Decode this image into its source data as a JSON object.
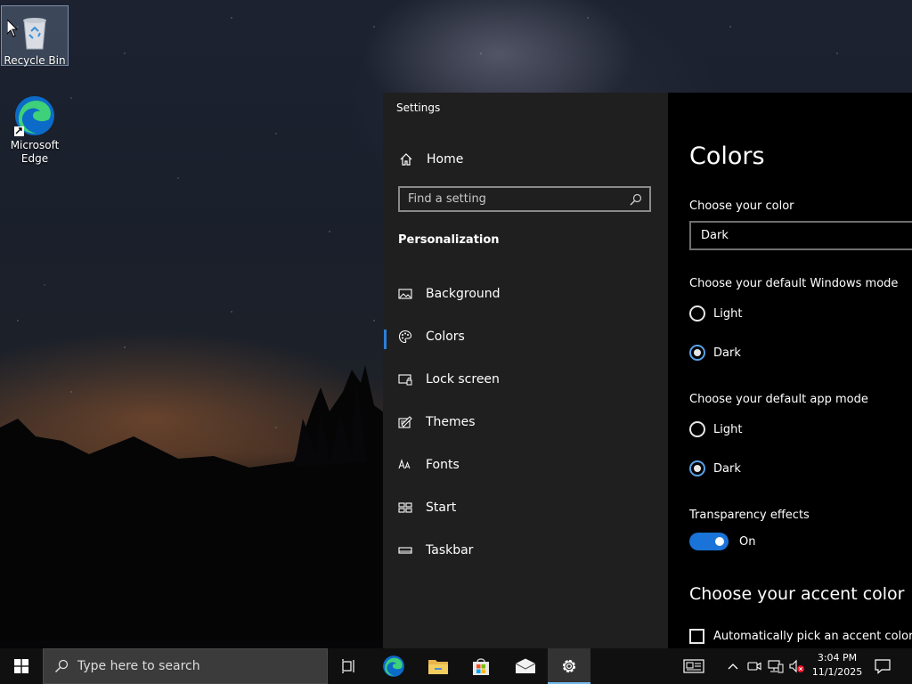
{
  "desktop": {
    "icons": [
      {
        "label": "Recycle Bin",
        "icon": "recycle-bin-icon",
        "selected": true
      },
      {
        "label": "Microsoft Edge",
        "icon": "edge-icon",
        "selected": false
      }
    ]
  },
  "settings": {
    "window_title": "Settings",
    "home_label": "Home",
    "search_placeholder": "Find a setting",
    "section_heading": "Personalization",
    "nav_items": [
      {
        "label": "Background",
        "icon": "picture-icon"
      },
      {
        "label": "Colors",
        "icon": "palette-icon",
        "active": true
      },
      {
        "label": "Lock screen",
        "icon": "lock-screen-icon"
      },
      {
        "label": "Themes",
        "icon": "themes-icon"
      },
      {
        "label": "Fonts",
        "icon": "fonts-icon"
      },
      {
        "label": "Start",
        "icon": "start-icon"
      },
      {
        "label": "Taskbar",
        "icon": "taskbar-icon"
      }
    ],
    "colors": {
      "title": "Colors",
      "choose_color_label": "Choose your color",
      "choose_color_value": "Dark",
      "windows_mode_label": "Choose your default Windows mode",
      "windows_mode_options": [
        "Light",
        "Dark"
      ],
      "windows_mode_selected": "Dark",
      "app_mode_label": "Choose your default app mode",
      "app_mode_options": [
        "Light",
        "Dark"
      ],
      "app_mode_selected": "Dark",
      "transparency_label": "Transparency effects",
      "transparency_state": "On",
      "accent_heading": "Choose your accent color",
      "auto_accent_label": "Automatically pick an accent color f",
      "auto_accent_checked": false
    },
    "accent_color": "#1a73d8"
  },
  "taskbar": {
    "search_placeholder": "Type here to search",
    "time": "3:04 PM",
    "date": "11/1/2025",
    "pinned": [
      "task-view-icon",
      "edge-icon",
      "file-explorer-icon",
      "store-icon",
      "mail-icon",
      "settings-icon"
    ],
    "tray": [
      "news-icon",
      "chevron-up-icon",
      "meet-now-icon",
      "network-icon",
      "volume-muted-icon",
      "notifications-icon"
    ]
  }
}
